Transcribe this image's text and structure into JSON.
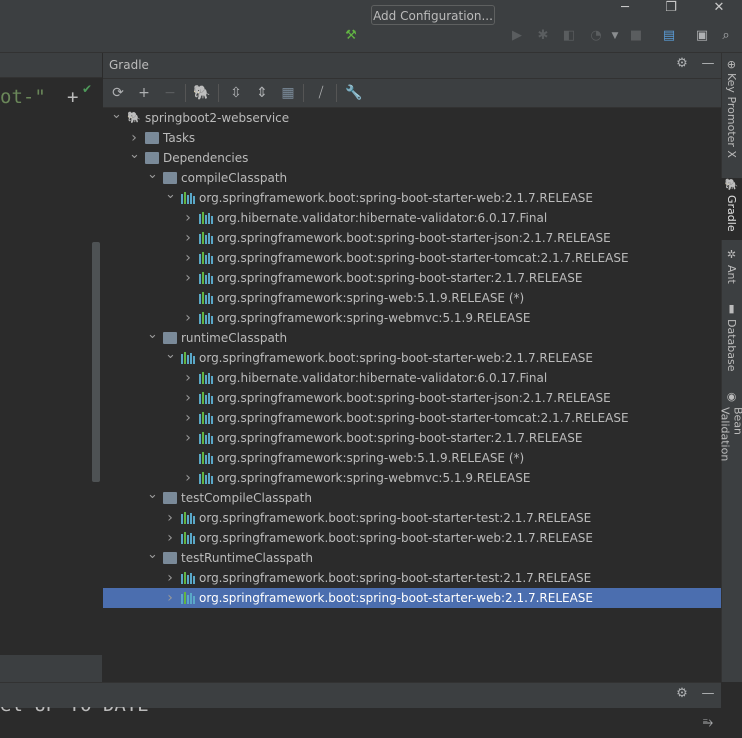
{
  "window": {
    "minimize_icon": "minimize-icon",
    "restore_icon": "restore-icon",
    "close_icon": "close-icon"
  },
  "toolbar": {
    "add_configuration_label": "Add Configuration...",
    "icons": [
      "build-hammer-icon",
      "run-icon",
      "debug-icon",
      "coverage-icon",
      "profile-icon",
      "stop-icon",
      "project-structure-icon",
      "layout-icon",
      "search-icon"
    ]
  },
  "editor": {
    "code_text": "ot-\"",
    "plus": "+",
    "bottom_text": "el UP TO DATE"
  },
  "gradle": {
    "title": "Gradle",
    "toolbar_icons": [
      "refresh-icon",
      "add-icon",
      "remove-icon",
      "gradle-elephant-icon",
      "expand-all-icon",
      "collapse-all-icon",
      "group-modules-icon",
      "toggle-offline-icon",
      "settings-wrench-icon"
    ],
    "tree": [
      {
        "label": "springboot2-webservice",
        "kind": "project",
        "level": 0,
        "expanded": true
      },
      {
        "label": "Tasks",
        "kind": "tasks",
        "level": 1,
        "expanded": false
      },
      {
        "label": "Dependencies",
        "kind": "folder",
        "level": 1,
        "expanded": true
      },
      {
        "label": "compileClasspath",
        "kind": "folder",
        "level": 2,
        "expanded": true
      },
      {
        "label": "org.springframework.boot:spring-boot-starter-web:2.1.7.RELEASE",
        "kind": "dep",
        "level": 3,
        "expanded": true
      },
      {
        "label": "org.hibernate.validator:hibernate-validator:6.0.17.Final",
        "kind": "dep",
        "level": 4,
        "expanded": false
      },
      {
        "label": "org.springframework.boot:spring-boot-starter-json:2.1.7.RELEASE",
        "kind": "dep",
        "level": 4,
        "expanded": false
      },
      {
        "label": "org.springframework.boot:spring-boot-starter-tomcat:2.1.7.RELEASE",
        "kind": "dep",
        "level": 4,
        "expanded": false
      },
      {
        "label": "org.springframework.boot:spring-boot-starter:2.1.7.RELEASE",
        "kind": "dep",
        "level": 4,
        "expanded": false
      },
      {
        "label": "org.springframework:spring-web:5.1.9.RELEASE (*)",
        "kind": "dep",
        "level": 4,
        "leaf": true
      },
      {
        "label": "org.springframework:spring-webmvc:5.1.9.RELEASE",
        "kind": "dep",
        "level": 4,
        "expanded": false
      },
      {
        "label": "runtimeClasspath",
        "kind": "folder",
        "level": 2,
        "expanded": true
      },
      {
        "label": "org.springframework.boot:spring-boot-starter-web:2.1.7.RELEASE",
        "kind": "dep",
        "level": 3,
        "expanded": true
      },
      {
        "label": "org.hibernate.validator:hibernate-validator:6.0.17.Final",
        "kind": "dep",
        "level": 4,
        "expanded": false
      },
      {
        "label": "org.springframework.boot:spring-boot-starter-json:2.1.7.RELEASE",
        "kind": "dep",
        "level": 4,
        "expanded": false
      },
      {
        "label": "org.springframework.boot:spring-boot-starter-tomcat:2.1.7.RELEASE",
        "kind": "dep",
        "level": 4,
        "expanded": false
      },
      {
        "label": "org.springframework.boot:spring-boot-starter:2.1.7.RELEASE",
        "kind": "dep",
        "level": 4,
        "expanded": false
      },
      {
        "label": "org.springframework:spring-web:5.1.9.RELEASE (*)",
        "kind": "dep",
        "level": 4,
        "leaf": true
      },
      {
        "label": "org.springframework:spring-webmvc:5.1.9.RELEASE",
        "kind": "dep",
        "level": 4,
        "expanded": false
      },
      {
        "label": "testCompileClasspath",
        "kind": "folder",
        "level": 2,
        "expanded": true
      },
      {
        "label": "org.springframework.boot:spring-boot-starter-test:2.1.7.RELEASE",
        "kind": "dep",
        "level": 3,
        "expanded": false
      },
      {
        "label": "org.springframework.boot:spring-boot-starter-web:2.1.7.RELEASE",
        "kind": "dep",
        "level": 3,
        "expanded": false
      },
      {
        "label": "testRuntimeClasspath",
        "kind": "folder",
        "level": 2,
        "expanded": true
      },
      {
        "label": "org.springframework.boot:spring-boot-starter-test:2.1.7.RELEASE",
        "kind": "dep",
        "level": 3,
        "expanded": false
      },
      {
        "label": "org.springframework.boot:spring-boot-starter-web:2.1.7.RELEASE",
        "kind": "dep",
        "level": 3,
        "expanded": false,
        "selected": true
      }
    ]
  },
  "right_tabs": [
    {
      "label": "Key Promoter X",
      "icon": "key-promoter-icon",
      "active": false
    },
    {
      "label": "Gradle",
      "icon": "gradle-icon",
      "active": true
    },
    {
      "label": "Ant",
      "icon": "ant-icon",
      "active": false
    },
    {
      "label": "Database",
      "icon": "database-icon",
      "active": false
    },
    {
      "label": "Bean Validation",
      "icon": "bean-validation-icon",
      "active": false
    }
  ],
  "colors": {
    "selection": "#4b6eaf",
    "background": "#2b2b2b",
    "panel": "#3c3f41",
    "string_green": "#6a8759"
  }
}
